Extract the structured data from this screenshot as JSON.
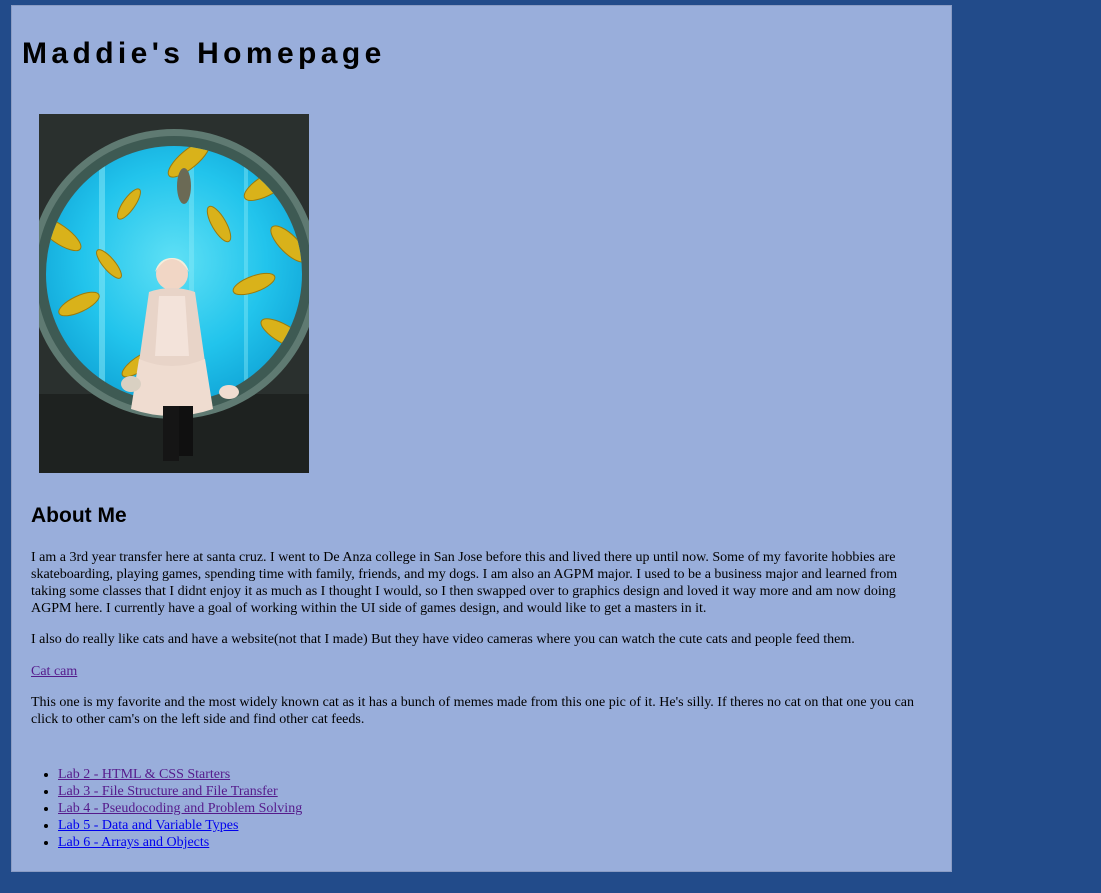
{
  "page": {
    "title": "Maddie's Homepage",
    "colors": {
      "outer_background": "#224b8a",
      "panel_background": "#99aedb",
      "visited_link": "#551a8b",
      "unvisited_link": "#0000ee"
    }
  },
  "about": {
    "heading": "About Me",
    "paragraph1": "I am a 3rd year transfer here at santa cruz. I went to De Anza college in San Jose before this and lived there up until now. Some of my favorite hobbies are skateboarding, playing games, spending time with family, friends, and my dogs. I am also an AGPM major. I used to be a business major and learned from taking some classes that I didnt enjoy it as much as I thought I would, so I then swapped over to graphics design and loved it way more and am now doing AGPM here. I currently have a goal of working within the UI side of games design, and would like to get a masters in it.",
    "paragraph2": "I also do really like cats and have a website(not that I made) But they have video cameras where you can watch the cute cats and people feed them.",
    "cat_link": "Cat cam",
    "paragraph3": "This one is my favorite and the most widely known cat as it has a bunch of memes made from this one pic of it. He's silly. If theres no cat on that one you can click to other cam's on the left side and find other cat feeds."
  },
  "labs": [
    {
      "label": "Lab 2 - HTML & CSS Starters",
      "visited": true
    },
    {
      "label": "Lab 3 - File Structure and File Transfer",
      "visited": true
    },
    {
      "label": "Lab 4 - Pseudocoding and Problem Solving",
      "visited": true
    },
    {
      "label": "Lab 5 - Data and Variable Types",
      "visited": false
    },
    {
      "label": "Lab 6 - Arrays and Objects",
      "visited": false
    }
  ]
}
